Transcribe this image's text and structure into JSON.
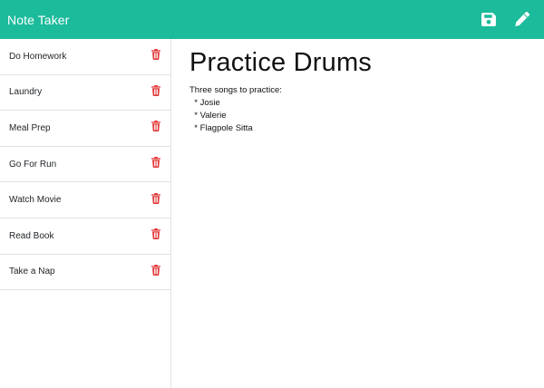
{
  "app": {
    "brand": "Note Taker",
    "accent_color": "#1bbb9b",
    "icons": {
      "save": "save-icon",
      "new_note": "pencil-icon",
      "delete": "trash-icon"
    },
    "delete_color": "#e23b3b"
  },
  "notes": [
    {
      "title": "Do Homework"
    },
    {
      "title": "Laundry"
    },
    {
      "title": "Meal Prep"
    },
    {
      "title": "Go For Run"
    },
    {
      "title": "Watch Movie"
    },
    {
      "title": "Read Book"
    },
    {
      "title": "Take a Nap"
    }
  ],
  "active_note": {
    "title": "Practice Drums",
    "text": "Three songs to practice:\n  * Josie\n  * Valerie\n  * Flagpole Sitta"
  }
}
